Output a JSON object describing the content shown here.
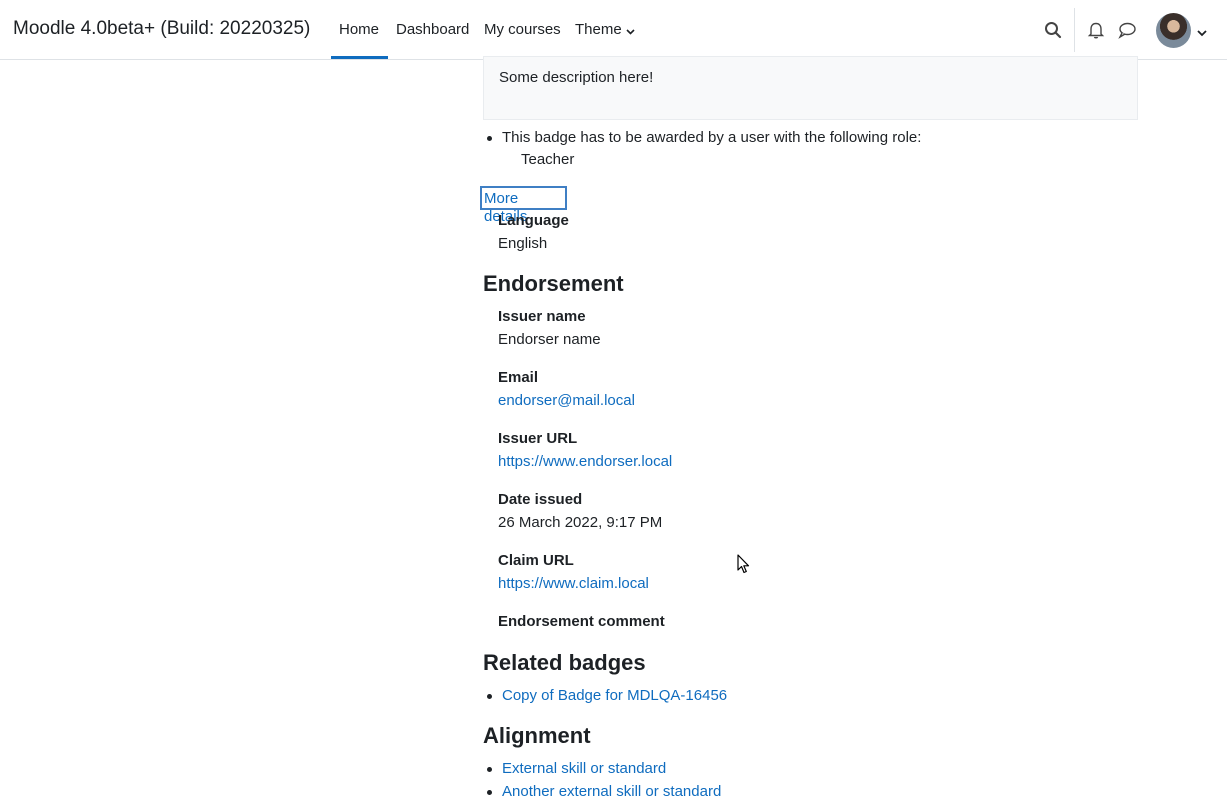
{
  "navbar": {
    "brand": "Moodle 4.0beta+ (Build: 20220325)",
    "links": [
      "Home",
      "Dashboard",
      "My courses",
      "Theme"
    ],
    "active": "Home",
    "icons": [
      "search-icon",
      "bell-icon",
      "chat-icon",
      "user-avatar"
    ]
  },
  "badge": {
    "description": "Some description here!",
    "criteria_text": "This badge has to be awarded by a user with the following role:",
    "criteria_role": "Teacher",
    "more_details_link": "More details",
    "language_label": "Language",
    "language_value": "English"
  },
  "endorsement": {
    "heading": "Endorsement",
    "issuer_name_label": "Issuer name",
    "issuer_name_value": "Endorser name",
    "email_label": "Email",
    "email_value": "endorser@mail.local",
    "issuer_url_label": "Issuer URL",
    "issuer_url_value": "https://www.endorser.local",
    "date_issued_label": "Date issued",
    "date_issued_value": "26 March 2022, 9:17 PM",
    "claim_url_label": "Claim URL",
    "claim_url_value": "https://www.claim.local",
    "comment_label": "Endorsement comment"
  },
  "related": {
    "heading": "Related badges",
    "items": [
      "Copy of Badge for MDLQA-16456"
    ]
  },
  "alignment": {
    "heading": "Alignment",
    "items": [
      "External skill or standard",
      "Another external skill or standard"
    ]
  },
  "colors": {
    "link": "#0f6cbf",
    "text": "#1d2125",
    "active_underline": "#0f6cbf",
    "focus_outline": "#3f7fc4"
  }
}
